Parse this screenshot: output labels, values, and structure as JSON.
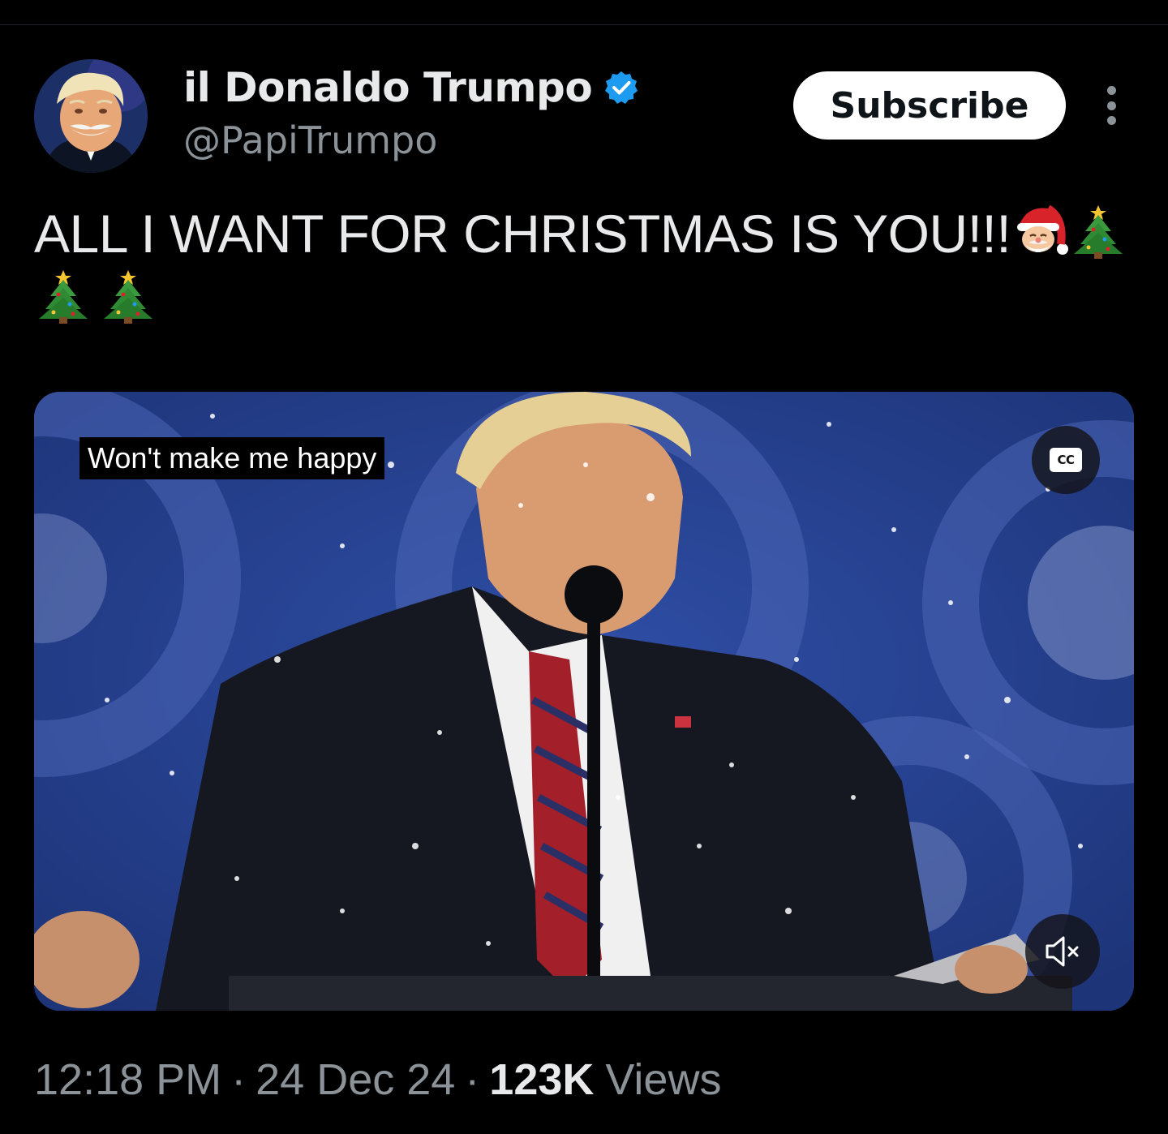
{
  "author": {
    "display_name": "il Donaldo Trumpo",
    "handle": "@PapiTrumpo",
    "verified": true
  },
  "actions": {
    "subscribe_label": "Subscribe"
  },
  "tweet": {
    "text": "ALL I WANT FOR CHRISTMAS IS YOU!!!",
    "emojis_inline": [
      "santa-emoji",
      "christmas-tree-emoji"
    ],
    "emojis_second_line": [
      "christmas-tree-emoji",
      "christmas-tree-emoji"
    ]
  },
  "media": {
    "type": "video",
    "caption": "Won't make me happy",
    "cc_label": "CC",
    "muted": true
  },
  "meta": {
    "time": "12:18 PM",
    "separator": "·",
    "date": "24 Dec 24",
    "views_count": "123K",
    "views_label": "Views"
  },
  "colors": {
    "background": "#000000",
    "primary_text": "#e7e9ea",
    "secondary_text": "#8b9298",
    "verified_blue": "#1d9bf0",
    "subscribe_bg": "#ffffff"
  }
}
